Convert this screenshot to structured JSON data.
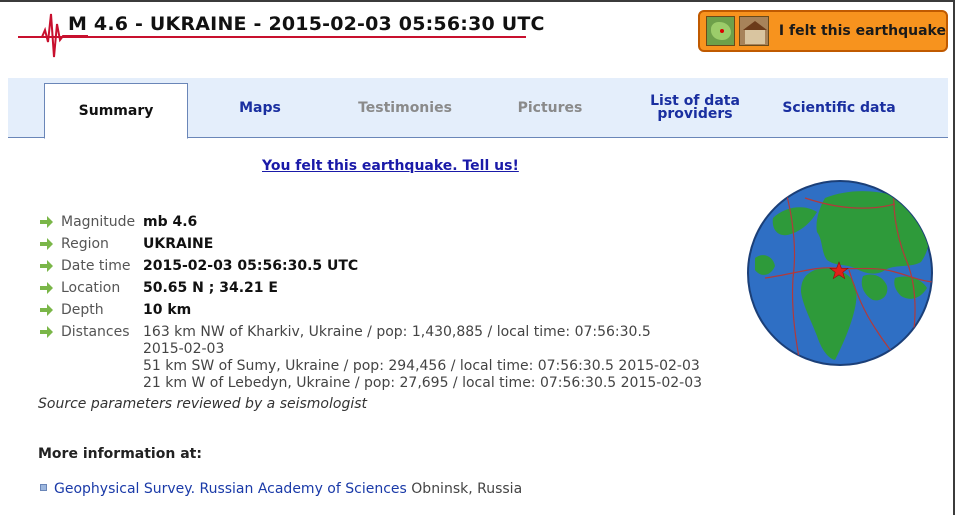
{
  "header": {
    "title": "M 4.6 - UKRAINE - 2015-02-03 05:56:30 UTC",
    "felt_button_label": "I felt this earthquake"
  },
  "tabs": [
    {
      "label": "Summary",
      "state": "active"
    },
    {
      "label": "Maps",
      "state": "enabled"
    },
    {
      "label": "Testimonies",
      "state": "disabled"
    },
    {
      "label": "Pictures",
      "state": "disabled"
    },
    {
      "label_line1": "List of data",
      "label_line2": "providers",
      "state": "enabled"
    },
    {
      "label": "Scientific data",
      "state": "enabled"
    }
  ],
  "felt_link": "You felt this earthquake. Tell us!",
  "details": {
    "magnitude": {
      "label": "Magnitude",
      "value": "mb 4.6"
    },
    "region": {
      "label": "Region",
      "value": "UKRAINE"
    },
    "date_time": {
      "label": "Date time",
      "value": "2015-02-03 05:56:30.5 UTC"
    },
    "location": {
      "label": "Location",
      "value": "50.65 N ; 34.21 E"
    },
    "depth": {
      "label": "Depth",
      "value": "10 km"
    },
    "distances": {
      "label": "Distances",
      "lines": [
        "163 km NW of Kharkiv, Ukraine / pop: 1,430,885 / local time: 07:56:30.5",
        "2015-02-03",
        "51 km SW of Sumy, Ukraine / pop: 294,456 / local time: 07:56:30.5 2015-02-03",
        "21 km W of Lebedyn, Ukraine / pop: 27,695 / local time: 07:56:30.5 2015-02-03"
      ]
    }
  },
  "source_note": "Source parameters reviewed by a seismologist",
  "more_info": {
    "heading": "More information at:",
    "provider_name": "Geophysical Survey. Russian Academy of Sciences",
    "provider_place": "Obninsk, Russia"
  },
  "colors": {
    "accent_orange": "#f7931e",
    "tab_bar": "#e4eefb",
    "link_blue": "#1a1aa8",
    "seismo_red": "#c8102e",
    "arrow_green": "#7ab648",
    "ocean": "#2f6fc4",
    "land": "#2e9a3a"
  }
}
